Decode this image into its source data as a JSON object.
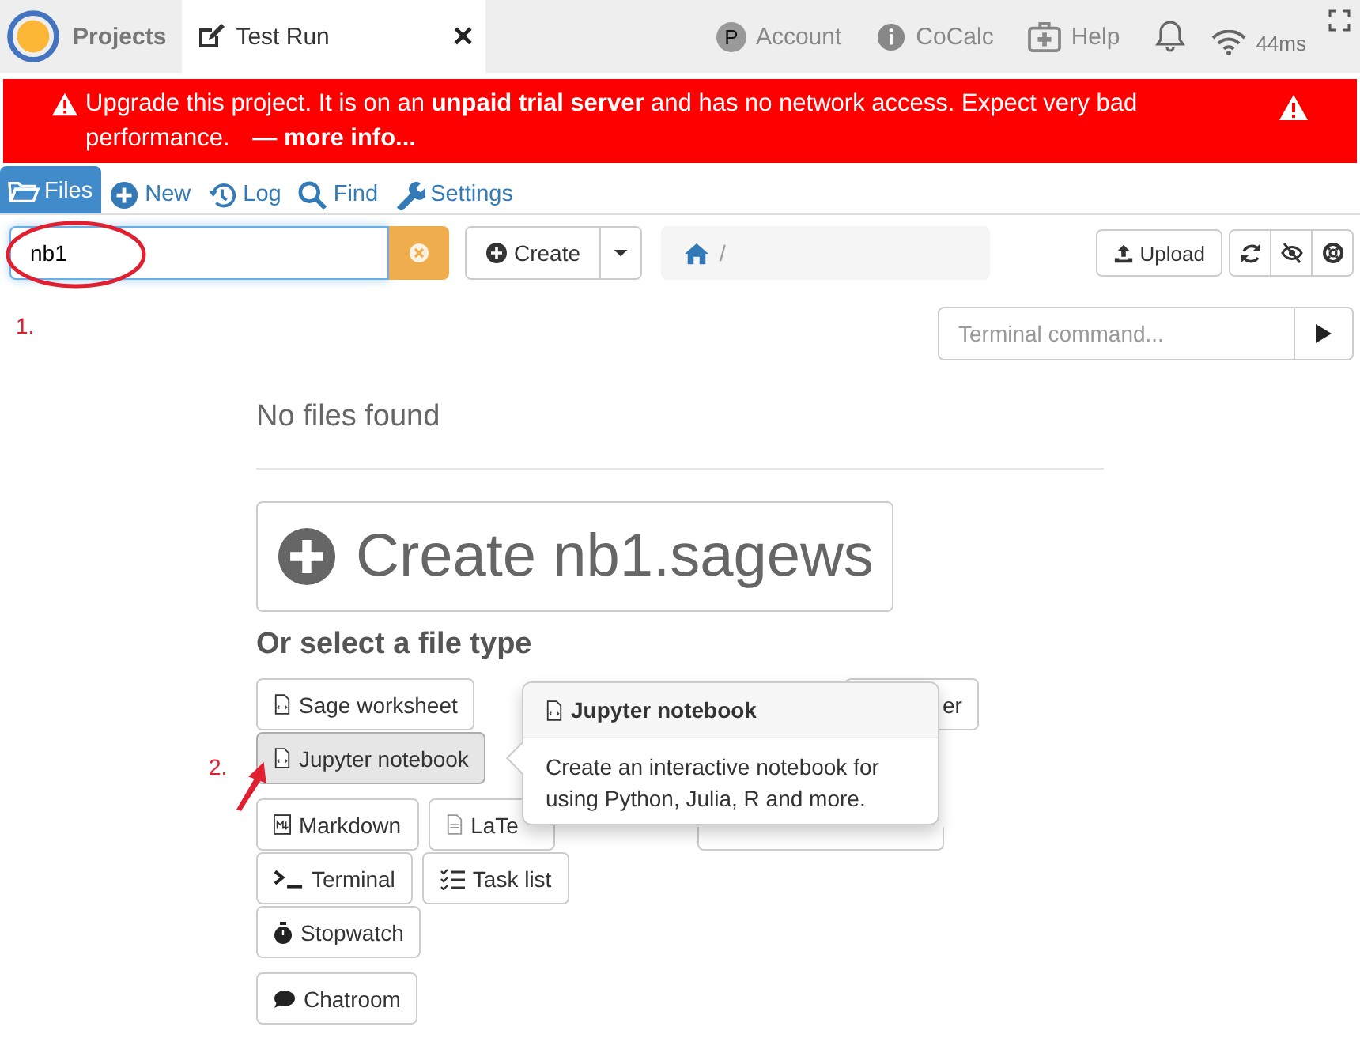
{
  "top_nav": {
    "projects": "Projects",
    "tab": {
      "title": "Test Run",
      "close": "×"
    },
    "items": [
      {
        "kind": "avatar",
        "avatar": "P",
        "label": "Account"
      },
      {
        "kind": "info",
        "label": "CoCalc"
      },
      {
        "kind": "help",
        "label": "Help"
      }
    ],
    "ping": "44ms"
  },
  "banner": {
    "text": "Upgrade this project. It is on an **unpaid trial server** and has no network access. Expect very bad performance.",
    "link": "— more info..."
  },
  "project_tabs": [
    {
      "kind": "files",
      "label": "Files",
      "selected": true
    },
    {
      "kind": "new",
      "label": "New",
      "selected": false
    },
    {
      "kind": "log",
      "label": "Log",
      "selected": false
    },
    {
      "kind": "find",
      "label": "Find",
      "selected": false
    },
    {
      "kind": "settings",
      "label": "Settings",
      "selected": false
    }
  ],
  "search": {
    "value": "nb1"
  },
  "create_button": "Create",
  "path": "/",
  "upload": "Upload",
  "terminal": {
    "placeholder": "Terminal command..."
  },
  "no_files": "No files found",
  "create_big": "Create nb1.sagews",
  "file_type_heading": "Or select a file type",
  "file_type_rows": [
    [
      {
        "kind": "sage",
        "label": "Sage worksheet",
        "selected": false
      },
      {
        "kind": "partial",
        "label": "er",
        "selected": false
      }
    ],
    [
      {
        "kind": "jupyter",
        "label": "Jupyter notebook",
        "selected": true
      }
    ],
    [
      {
        "kind": "markdown",
        "label": "Markdown",
        "selected": false
      },
      {
        "kind": "latex",
        "label": "LaTe",
        "selected": false
      },
      {
        "kind": "hidden-wide"
      }
    ],
    [
      {
        "kind": "terminal",
        "label": "Terminal",
        "selected": false
      },
      {
        "kind": "tasks",
        "label": "Task list",
        "selected": false
      }
    ],
    [
      {
        "kind": "stopwatch",
        "label": "Stopwatch",
        "selected": false
      }
    ],
    [
      {
        "kind": "chat",
        "label": "Chatroom",
        "selected": false
      }
    ]
  ],
  "popover": {
    "title": "Jupyter notebook",
    "text": "Create an interactive notebook for using Python, Julia, R and more."
  },
  "annotations": [
    {
      "label": "1."
    },
    {
      "label": "2."
    }
  ]
}
